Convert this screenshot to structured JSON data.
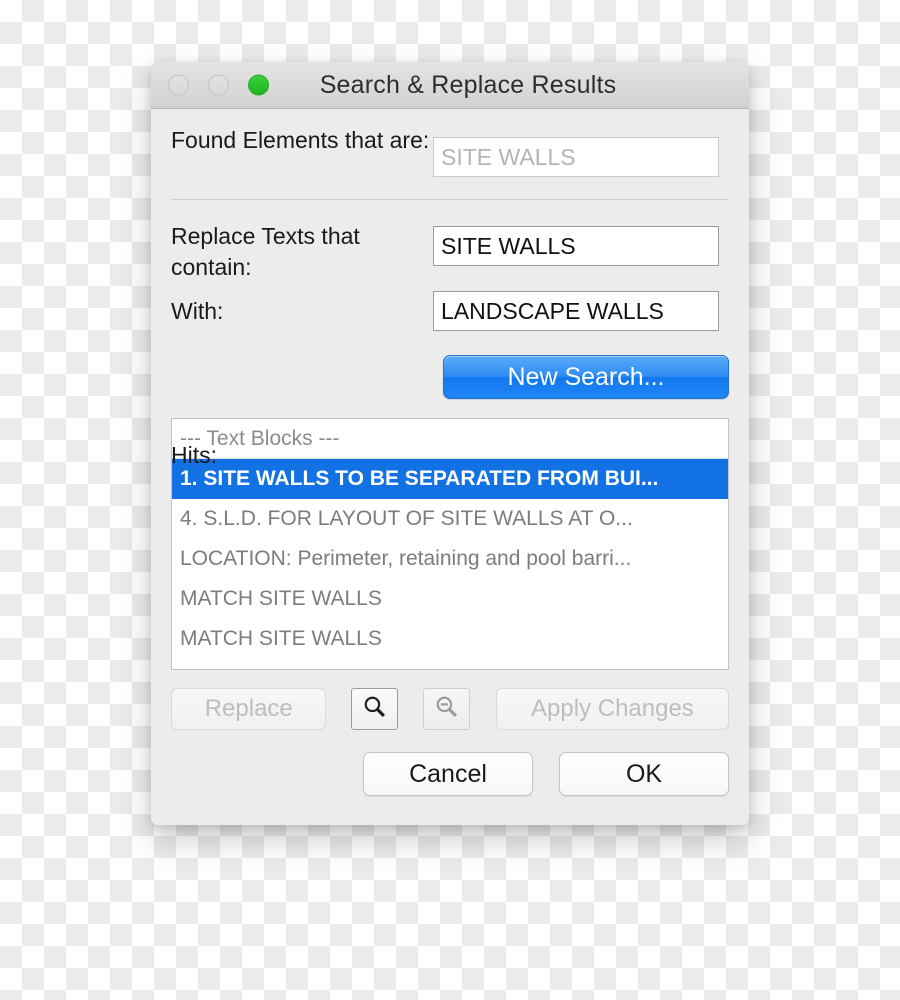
{
  "window": {
    "title": "Search & Replace Results",
    "traffic_lights": [
      {
        "name": "close",
        "state": "disabled",
        "color": "#dcdcdc"
      },
      {
        "name": "minimize",
        "state": "disabled",
        "color": "#dcdcdc"
      },
      {
        "name": "zoom",
        "state": "enabled",
        "color": "#28bf28"
      }
    ]
  },
  "form": {
    "found_label": "Found Elements that are:",
    "found_value": "SITE WALLS",
    "replace_label": "Replace Texts that contain:",
    "replace_value": "SITE WALLS",
    "with_label": "With:",
    "with_value": "LANDSCAPE WALLS",
    "new_search_label": "New Search...",
    "hits_label": "Hits:"
  },
  "hits": {
    "group_header": "---  Text Blocks  ---",
    "items": [
      {
        "text": "1. SITE WALLS TO BE SEPARATED FROM BUI...",
        "selected": true
      },
      {
        "text": "4.  S.L.D. FOR LAYOUT OF SITE WALLS AT O...",
        "selected": false
      },
      {
        "text": "LOCATION: Perimeter, retaining and pool barri...",
        "selected": false
      },
      {
        "text": "MATCH SITE WALLS",
        "selected": false
      },
      {
        "text": "MATCH SITE WALLS",
        "selected": false
      }
    ]
  },
  "actions": {
    "replace_label": "Replace",
    "apply_label": "Apply Changes",
    "zoom_in_icon": "magnifier-icon",
    "zoom_out_icon": "magnifier-minus-icon",
    "cancel_label": "Cancel",
    "ok_label": "OK"
  },
  "colors": {
    "accent_blue": "#1272e4",
    "default_button_blue": "#2f8cf3",
    "window_bg": "#ececec",
    "green_light": "#28bf28"
  }
}
